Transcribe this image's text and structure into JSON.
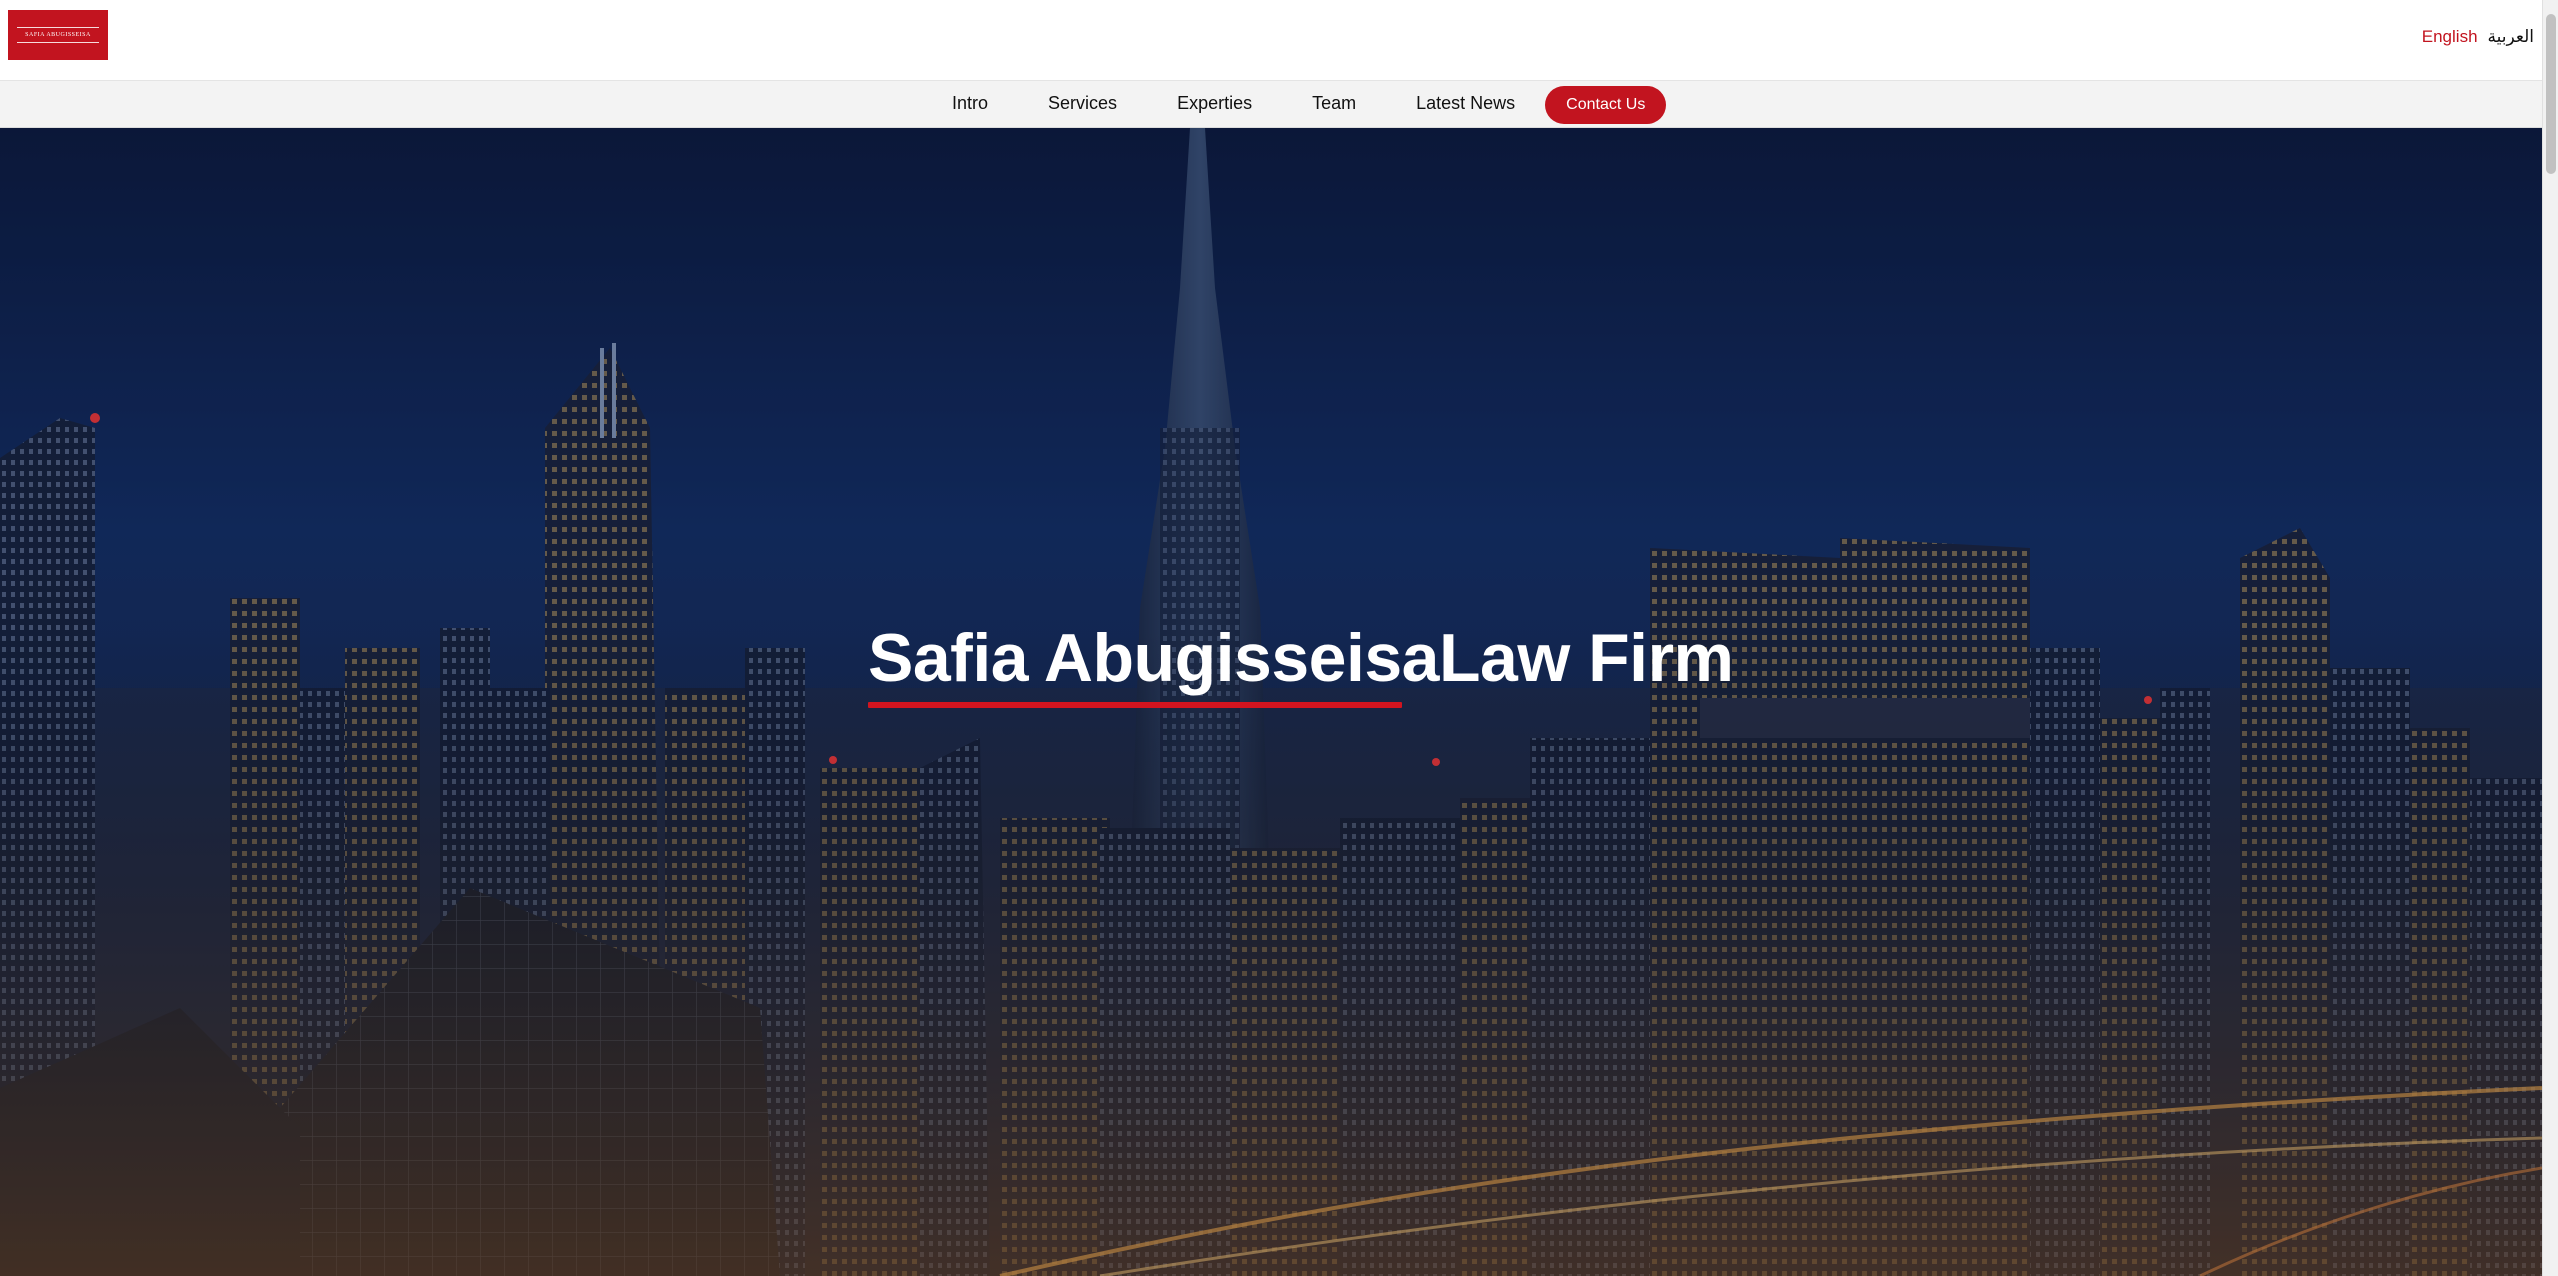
{
  "header": {
    "logo_text": "SAFIA ABUGISSEISA",
    "languages": {
      "english": "English",
      "arabic": "العربية"
    }
  },
  "nav": {
    "items": [
      {
        "label": "Intro"
      },
      {
        "label": "Services"
      },
      {
        "label": "Experties"
      },
      {
        "label": "Team"
      },
      {
        "label": "Latest News"
      }
    ],
    "contact_label": "Contact Us"
  },
  "hero": {
    "title": "Safia AbugisseisaLaw Firm"
  },
  "colors": {
    "brand_red": "#c2141f",
    "nav_background": "#f3f3f3",
    "hero_night_blue": "#112a5a"
  }
}
